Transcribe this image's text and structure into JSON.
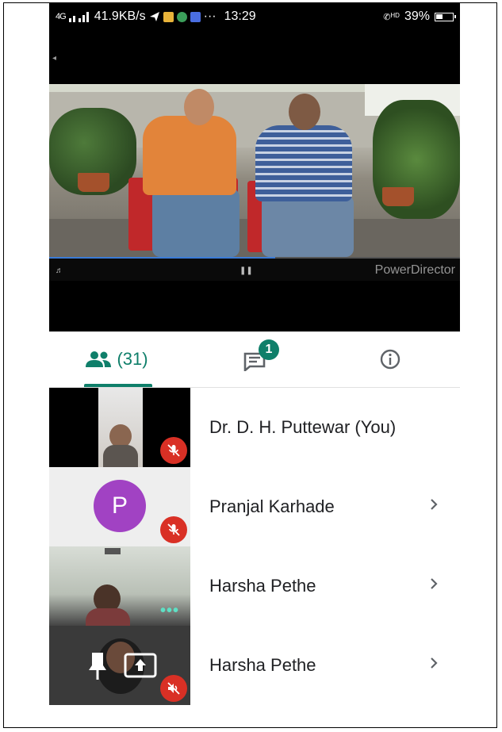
{
  "status_bar": {
    "network": "4G",
    "speed": "41.9KB/s",
    "more": "···",
    "time": "13:29",
    "call_label": "HD",
    "battery": "39%"
  },
  "video": {
    "watermark": "PowerDirector",
    "progress_fraction": 0.55
  },
  "tabs": {
    "people_count": "(31)",
    "chat_badge": "1"
  },
  "participants": [
    {
      "name": "Dr. D. H. Puttewar (You)",
      "muted": true
    },
    {
      "name": "Pranjal Karhade",
      "avatar_letter": "P",
      "avatar_color": "#a142c3",
      "muted": true
    },
    {
      "name": "Harsha Pethe",
      "muted": false
    },
    {
      "name": "Harsha Pethe",
      "muted": true
    }
  ],
  "colors": {
    "accent": "#0f7f6a",
    "mute": "#d93025"
  }
}
